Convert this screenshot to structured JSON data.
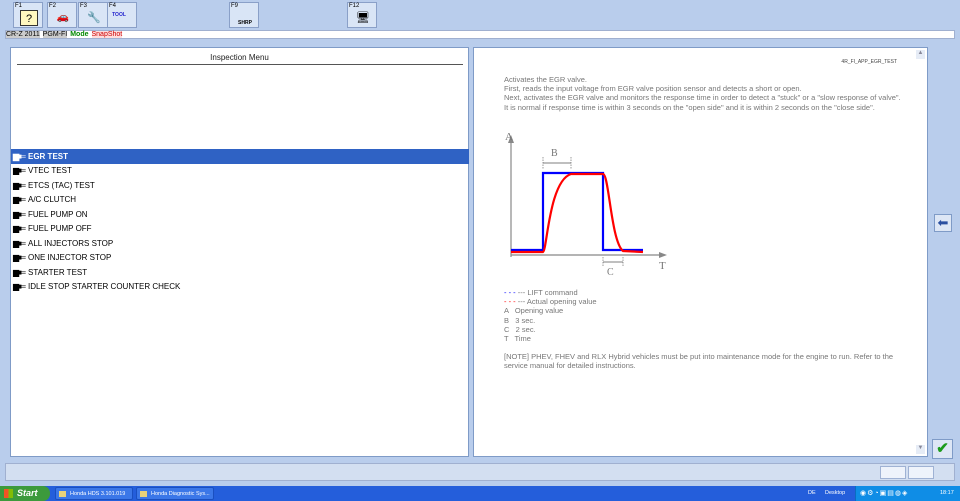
{
  "toolbar": {
    "keys": [
      {
        "key": "F1",
        "icon": "help-icon",
        "glyph": "?"
      },
      {
        "key": "F2",
        "icon": "car-icon",
        "glyph": "🚗"
      },
      {
        "key": "F3",
        "icon": "tools-icon",
        "glyph": "🔧"
      },
      {
        "key": "F4",
        "icon": "tool-select-icon",
        "glyph": "TOOL"
      },
      {
        "key": "F9",
        "icon": "shrp-icon",
        "glyph": "SHRP"
      },
      {
        "key": "F12",
        "icon": "computer-icon",
        "glyph": "🖥"
      }
    ]
  },
  "status": {
    "vehicle": "CR-Z 2011",
    "system": "PGM-FI",
    "mode_label": "Mode",
    "mode_value": "SnapShot"
  },
  "menu": {
    "title": "Inspection Menu",
    "items": [
      "EGR TEST",
      "VTEC TEST",
      "ETCS (TAC) TEST",
      "A/C CLUTCH",
      "FUEL PUMP ON",
      "FUEL PUMP OFF",
      "ALL INJECTORS STOP",
      "ONE INJECTOR STOP",
      "STARTER TEST",
      "IDLE STOP STARTER COUNTER CHECK"
    ]
  },
  "detail": {
    "code": "4R_FI_APP_EGR_TEST",
    "desc": "Activates the EGR valve.\nFirst, reads the input voltage from EGR valve position sensor and detects a short or open.\nNext, activates the EGR valve and monitors the response time in order to detect a \"stuck\" or a \"slow response of valve\". It is normal if response time is within 3 seconds on the \"open side\" and it is within 2 seconds on the \"close side\".",
    "graph": {
      "a": "A",
      "b": "B",
      "c": "C",
      "t": "T"
    },
    "legend": [
      "--- LIFT command",
      "--- Actual opening value",
      "A   Opening value",
      "B   3 sec.",
      "C   2 sec.",
      "T   Time"
    ],
    "note": "[NOTE] PHEV, FHEV and RLX Hybrid vehicles must be put into maintenance mode for the engine to run. Refer to the service manual for detailed instructions."
  },
  "colors": {
    "lift": "#0000ff",
    "actual": "#ff0000",
    "selection": "#2f62c4"
  },
  "taskbar": {
    "start": "Start",
    "tasks": [
      "Honda HDS 3.101.019",
      "Honda Diagnostic Sys..."
    ],
    "lang": "DE",
    "desktop": "Desktop",
    "time": "18:17"
  }
}
